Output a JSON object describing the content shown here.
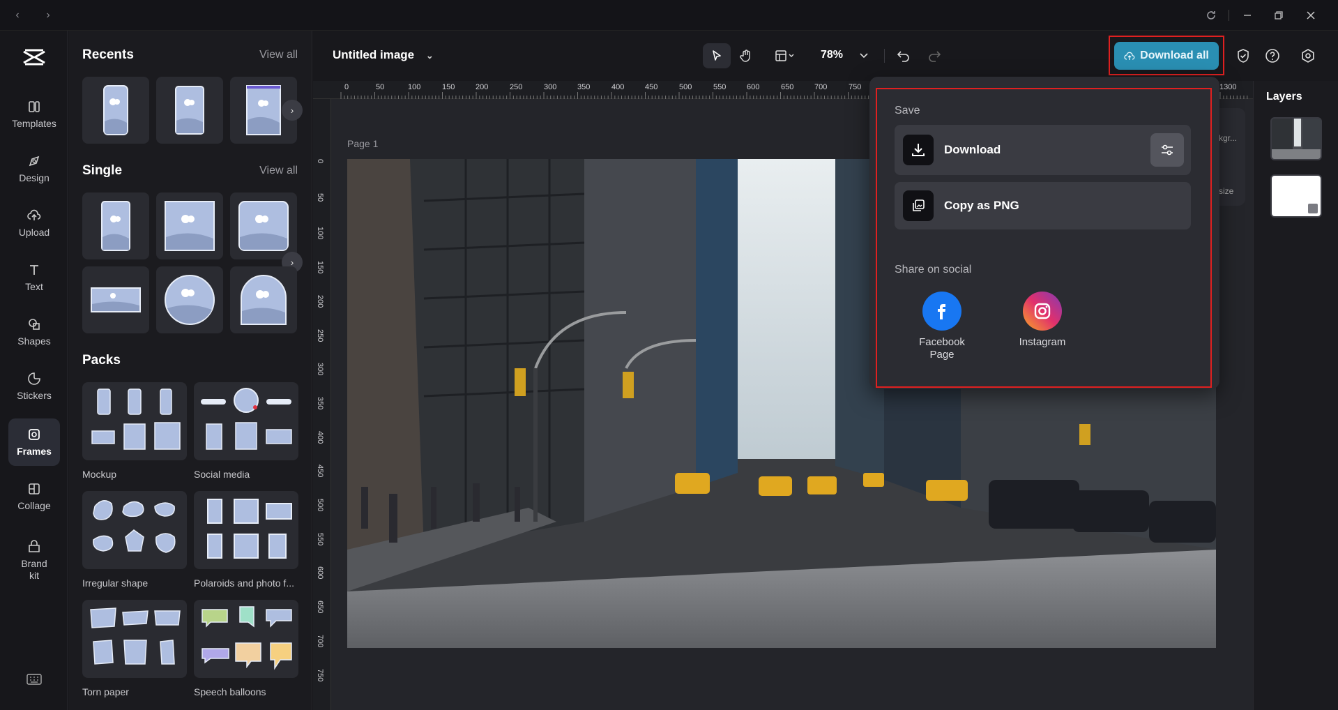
{
  "window": {
    "back_icon": "chevron-left-icon",
    "forward_icon": "chevron-right-icon",
    "refresh_icon": "refresh-icon",
    "minimize_icon": "minimize-icon",
    "restore_icon": "restore-icon",
    "close_icon": "close-icon"
  },
  "rail": {
    "items": [
      {
        "label": "Templates",
        "icon": "templates-icon"
      },
      {
        "label": "Design",
        "icon": "design-icon"
      },
      {
        "label": "Upload",
        "icon": "upload-icon"
      },
      {
        "label": "Text",
        "icon": "text-icon"
      },
      {
        "label": "Shapes",
        "icon": "shapes-icon"
      },
      {
        "label": "Stickers",
        "icon": "stickers-icon"
      },
      {
        "label": "Frames",
        "icon": "frames-icon",
        "active": true
      },
      {
        "label": "Collage",
        "icon": "collage-icon"
      },
      {
        "label": "Brand kit",
        "icon": "brand-kit-icon"
      }
    ],
    "keyboard_icon": "keyboard-icon"
  },
  "panel": {
    "recents_title": "Recents",
    "recents_view_all": "View all",
    "single_title": "Single",
    "single_view_all": "View all",
    "packs_title": "Packs",
    "packs": [
      {
        "label": "Mockup"
      },
      {
        "label": "Social media"
      },
      {
        "label": "Irregular shape"
      },
      {
        "label": "Polaroids and photo f..."
      },
      {
        "label": "Torn paper"
      },
      {
        "label": "Speech balloons"
      }
    ]
  },
  "topbar": {
    "doc_title": "Untitled image",
    "zoom": "78%",
    "download_all": "Download all"
  },
  "canvas": {
    "page_label": "Page 1",
    "ruler_top": [
      "0",
      "50",
      "100",
      "150",
      "200",
      "250",
      "300",
      "350",
      "400",
      "450",
      "500",
      "550",
      "600",
      "650",
      "700",
      "750",
      "1300"
    ],
    "ruler_left": [
      "0",
      "50",
      "100",
      "150",
      "200",
      "250",
      "300",
      "350",
      "400",
      "450",
      "500",
      "550",
      "600",
      "650",
      "700",
      "750"
    ]
  },
  "layers": {
    "title": "Layers",
    "side_tool_1": "kgr...",
    "side_tool_2": "size"
  },
  "dropdown": {
    "save_heading": "Save",
    "download_label": "Download",
    "copy_label": "Copy as PNG",
    "share_heading": "Share on social",
    "facebook_label": "Facebook Page",
    "instagram_label": "Instagram"
  },
  "colors": {
    "accent": "#2a8fb3",
    "highlight_outline": "#e02020",
    "facebook": "#1877f2"
  }
}
